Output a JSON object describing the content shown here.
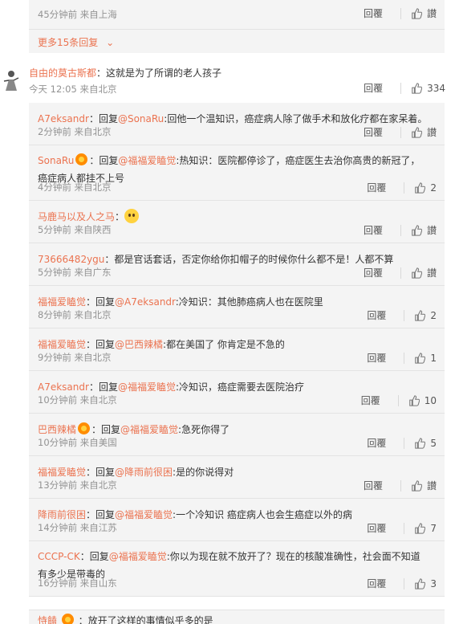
{
  "top_reply": {
    "meta": "45分钟前 来自上海",
    "reply_label": "回覆",
    "like_label": "讃"
  },
  "more_replies": {
    "label": "更多15条回复"
  },
  "main_comment": {
    "user": "自由的莫古斯都",
    "text": "：这就是为了所谓的老人孩子",
    "meta": "今天 12:05 来自北京",
    "reply_label": "回覆",
    "likes": "334"
  },
  "replies": [
    {
      "user": "A7eksandr",
      "badge": false,
      "prefix": "：回复",
      "mention": "@SonaRu",
      "text": ":回他一个温知识，癌症病人除了做手术和放化疗都在家呆着。",
      "meta": "2分钟前 来自北京",
      "reply_label": "回覆",
      "like": "讃",
      "tall": false
    },
    {
      "user": "SonaRu",
      "badge": true,
      "prefix": "：回复",
      "mention": "@福福爱瞌觉",
      "text": ":热知识：医院都停诊了，癌症医生去治你高贵的新冠了，癌症病人都挂不上号",
      "meta": "4分钟前 来自北京",
      "reply_label": "回覆",
      "like": "2",
      "tall": true
    },
    {
      "user": "马鹿马以及人之马",
      "badge": false,
      "prefix": "：",
      "mention": "",
      "text": "",
      "emoji": true,
      "meta": "5分钟前 来自陕西",
      "reply_label": "回覆",
      "like": "讃",
      "tall": false
    },
    {
      "user": "73666482ygu",
      "badge": false,
      "prefix": "：都是官话套话，否定你给你扣帽子的时候你什么都不是！人都不算",
      "mention": "",
      "text": "",
      "meta": "5分钟前 来自广东",
      "reply_label": "回覆",
      "like": "讃",
      "tall": false,
      "plainuser": true
    },
    {
      "user": "福福爱瞌觉",
      "badge": false,
      "prefix": "：回复",
      "mention": "@A7eksandr",
      "text": ":冷知识：其他肺癌病人也在医院里",
      "meta": "8分钟前 来自北京",
      "reply_label": "回覆",
      "like": "2",
      "tall": false
    },
    {
      "user": "福福爱瞌觉",
      "badge": false,
      "prefix": "：回复",
      "mention": "@巴西辣橘",
      "text": ":都在美国了 你肯定是不急的",
      "meta": "9分钟前 来自北京",
      "reply_label": "回覆",
      "like": "1",
      "tall": false
    },
    {
      "user": "A7eksandr",
      "badge": false,
      "prefix": "：回复",
      "mention": "@福福爱瞌觉",
      "text": ":冷知识，癌症需要去医院治疗",
      "meta": "10分钟前 来自北京",
      "reply_label": "回覆",
      "like": "10",
      "tall": false
    },
    {
      "user": "巴西辣橘",
      "badge": true,
      "prefix": "：回复",
      "mention": "@福福爱瞌觉",
      "text": ":急死你得了",
      "meta": "10分钟前 来自美国",
      "reply_label": "回覆",
      "like": "5",
      "tall": false
    },
    {
      "user": "福福爱瞌觉",
      "badge": false,
      "prefix": "：回复",
      "mention": "@降雨前很困",
      "text": ":是的你说得对",
      "meta": "13分钟前 来自北京",
      "reply_label": "回覆",
      "like": "讃",
      "tall": false
    },
    {
      "user": "降雨前很困",
      "badge": false,
      "prefix": "：回复",
      "mention": "@福福爱瞌觉",
      "text": ":一个冷知识 癌症病人也会生癌症以外的病",
      "meta": "14分钟前 来自江苏",
      "reply_label": "回覆",
      "like": "7",
      "tall": false
    },
    {
      "user": "CCCP-CK",
      "badge": false,
      "prefix": "：回复",
      "mention": "@福福爱瞌觉",
      "text": ":你以为现在就不放开了？现在的核酸准确性，社会面不知道有多少是带毒的",
      "meta": "16分钟前 来自山东",
      "reply_label": "回覆",
      "like": "3",
      "tall": true
    }
  ],
  "bottom_reply": {
    "user": "恃饁",
    "text": "：放开了这样的事情似乎多的是"
  }
}
